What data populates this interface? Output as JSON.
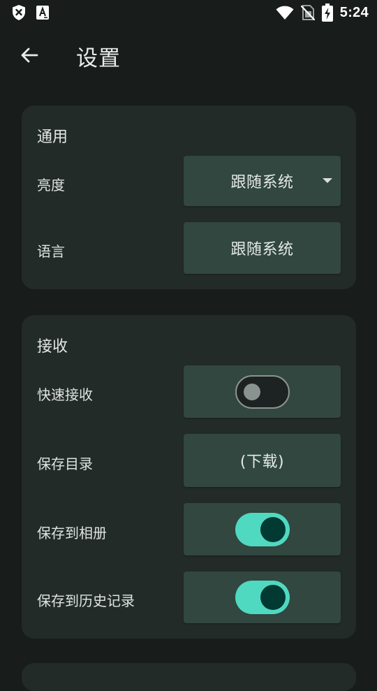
{
  "status_bar": {
    "time": "5:24",
    "left_icons": [
      "shield-x-icon",
      "font-a-icon"
    ],
    "right_icons": [
      "wifi-icon",
      "no-sim-icon",
      "battery-charging-icon"
    ]
  },
  "app_bar": {
    "title": "设置",
    "back_icon": "arrow-left-icon"
  },
  "sections": {
    "general": {
      "title": "通用",
      "brightness": {
        "label": "亮度",
        "value": "跟随系统"
      },
      "language": {
        "label": "语言",
        "value": "跟随系统"
      }
    },
    "receive": {
      "title": "接收",
      "quick_receive": {
        "label": "快速接收",
        "enabled": false
      },
      "save_directory": {
        "label": "保存目录",
        "value": "(下载)"
      },
      "save_to_gallery": {
        "label": "保存到相册",
        "enabled": true
      },
      "save_to_history": {
        "label": "保存到历史记录",
        "enabled": true
      }
    }
  },
  "colors": {
    "background": "#181c1b",
    "card": "#232b29",
    "control": "#31473f",
    "switch_on_track": "#4fd9c0",
    "switch_on_thumb": "#003a33",
    "switch_off_outline": "#8b9390"
  }
}
